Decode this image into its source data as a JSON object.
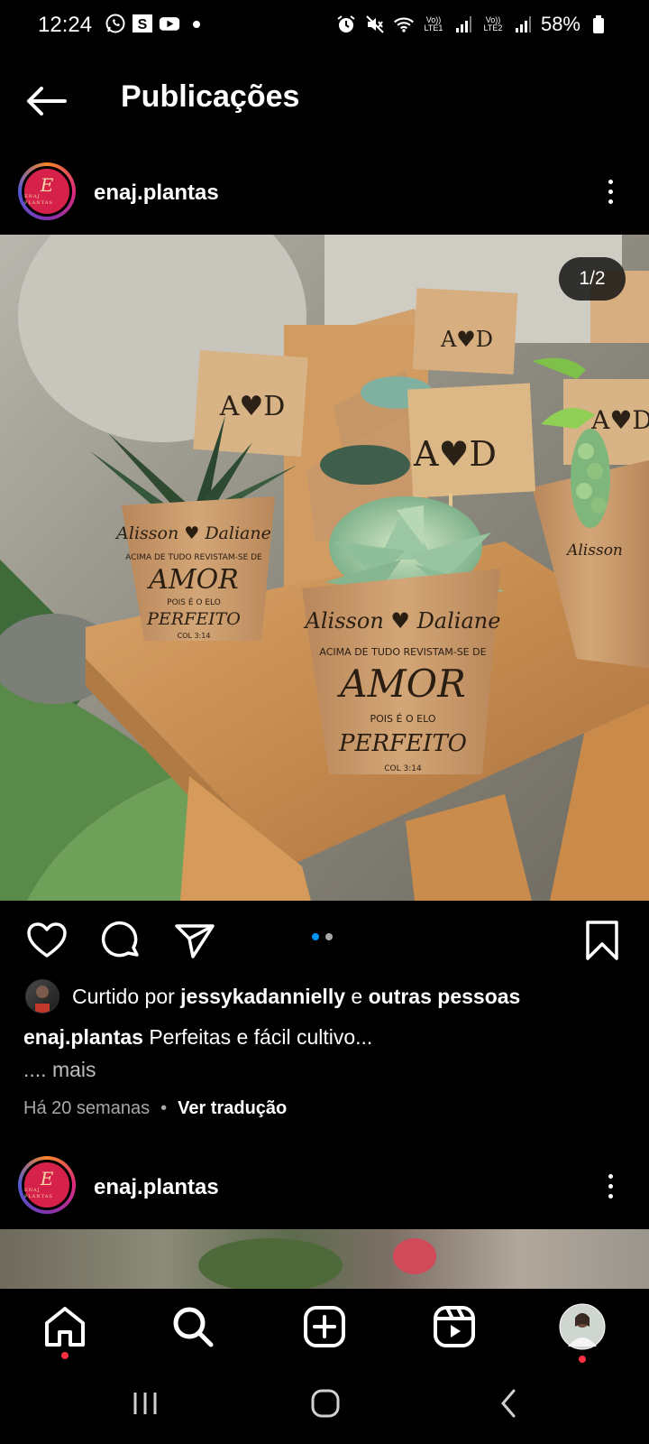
{
  "status_bar": {
    "time": "12:24",
    "lte1": "Vo)) LTE1",
    "lte2": "Vo)) LTE2",
    "battery": "58%"
  },
  "header": {
    "title": "Publicações"
  },
  "post": {
    "username": "enaj.plantas",
    "avatar_letter": "E",
    "avatar_subtext": "ENAJ PLANTAS",
    "image_counter": "1/2",
    "carousel_total": 2,
    "carousel_index": 1,
    "liked_prefix": "Curtido por ",
    "liked_user": "jessykadannielly",
    "liked_mid": " e ",
    "liked_others": "outras pessoas",
    "caption_user": "enaj.plantas",
    "caption_text": "Perfeitas e fácil cultivo...",
    "more": ".... mais",
    "time_ago": "Há 20 semanas",
    "separator": "•",
    "translate": "Ver tradução"
  },
  "next_post": {
    "username": "enaj.plantas"
  },
  "photo_text": {
    "tag_initials": "A♥D",
    "tag_a": "A",
    "tag_d": "D",
    "name_left": "Alisson",
    "name_right": "Daliane",
    "line1": "ACIMA DE TUDO REVISTAM-SE DE",
    "amor": "AMOR",
    "line2": "POIS É O ELO",
    "perfeito": "PERFEITO",
    "ref": "COL 3:14"
  },
  "nav": {
    "items": [
      "home-icon",
      "search-icon",
      "create-icon",
      "reels-icon",
      "profile-avatar"
    ]
  },
  "colors": {
    "accent_blue": "#0095f6",
    "notification_red": "#ff3040",
    "kraft": "#c99a66"
  }
}
